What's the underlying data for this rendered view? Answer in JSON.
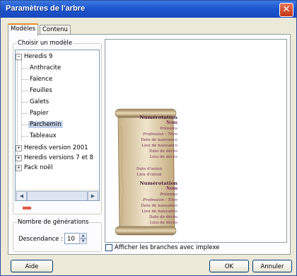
{
  "window": {
    "title": "Paramètres de l'arbre",
    "close_glyph": "✕"
  },
  "tabs": [
    {
      "label": "Modèles"
    },
    {
      "label": "Contenu"
    }
  ],
  "model_group": {
    "legend": "Choisir un modèle",
    "tree": [
      {
        "label": "Heredis 9",
        "expander": "−"
      },
      {
        "label": "Anthracite"
      },
      {
        "label": "Faïence"
      },
      {
        "label": "Feuilles"
      },
      {
        "label": "Galets"
      },
      {
        "label": "Papier"
      },
      {
        "label": "Parchemin",
        "selected": true
      },
      {
        "label": "Tableaux"
      },
      {
        "label": "Heredis version 2001",
        "expander": "+"
      },
      {
        "label": "Heredis versions 7 et 8",
        "expander": "+"
      },
      {
        "label": "Pack noël",
        "expander": "+"
      }
    ],
    "scroll_left": "◀",
    "scroll_right": "▶"
  },
  "generations_group": {
    "legend": "Nombre de générations",
    "field_label": "Descendance :",
    "value": "10"
  },
  "preview": {
    "scroll_lines_1": [
      "Numérotation",
      "Nom",
      "Prénoms",
      "Profession - Titre",
      "Date de naissance",
      "Lieu de naissance",
      "Date de décès",
      "Lieu de décès"
    ],
    "scroll_lines_2": [
      "Date d'union",
      "Lieu d'union"
    ],
    "scroll_lines_3": [
      "Numérotation",
      "Nom",
      "Prénoms",
      "Profession - Titre",
      "Date de naissance",
      "Lieu de naissance",
      "Date de décès",
      "Lieu de décès"
    ]
  },
  "implex_checkbox": {
    "label": "Afficher les branches avec implexe",
    "checked": false
  },
  "buttons": {
    "help": "Aide",
    "ok": "OK",
    "cancel": "Annuler"
  },
  "colors": {
    "titlebar": "#1d57cf",
    "accent": "#e68b2c",
    "selection": "#c4d1e9",
    "scroll_text": "#7a2c5c"
  }
}
